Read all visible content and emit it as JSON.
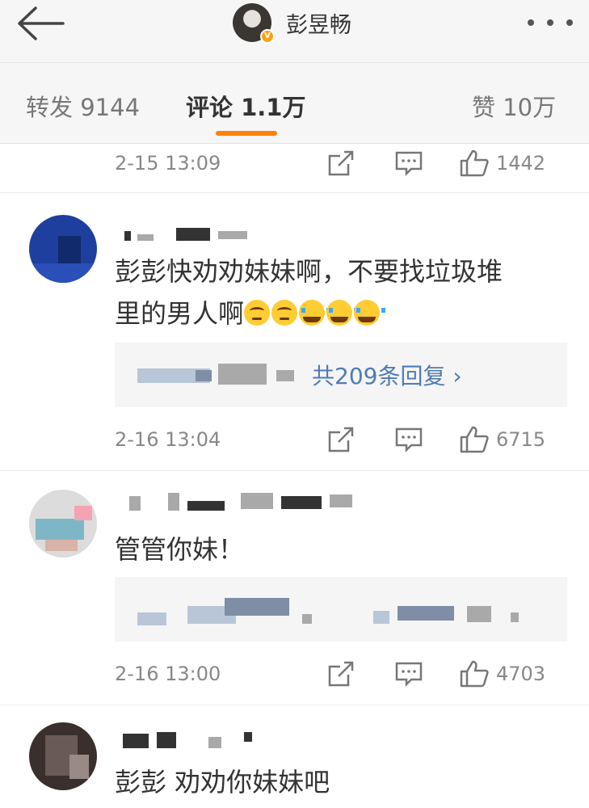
{
  "header": {
    "title": "彭昱畅",
    "badge": "V"
  },
  "tabs": [
    {
      "label": "转发 9144"
    },
    {
      "label": "评论 1.1万"
    },
    {
      "label": "赞 10万"
    }
  ],
  "comments": [
    {
      "date": "2-15 13:09",
      "likes": "1442"
    },
    {
      "date": "2-16 13:04",
      "likes": "6715",
      "text_line1": "彭彭快劝劝妹妹啊，不要找垃圾堆",
      "text_line2": "里的男人啊",
      "replies": "共209条回复 ›"
    },
    {
      "date": "2-16 13:00",
      "likes": "4703",
      "text": "管管你妹！"
    },
    {
      "text": "彭彭 劝劝你妹妹吧"
    }
  ],
  "colors": {
    "accent": "#ff8200",
    "link": "#4f7bb8",
    "verified": "#f7a21a"
  },
  "icons": [
    "back-arrow-icon",
    "more-icon",
    "repost-icon",
    "comment-icon",
    "like-icon"
  ]
}
